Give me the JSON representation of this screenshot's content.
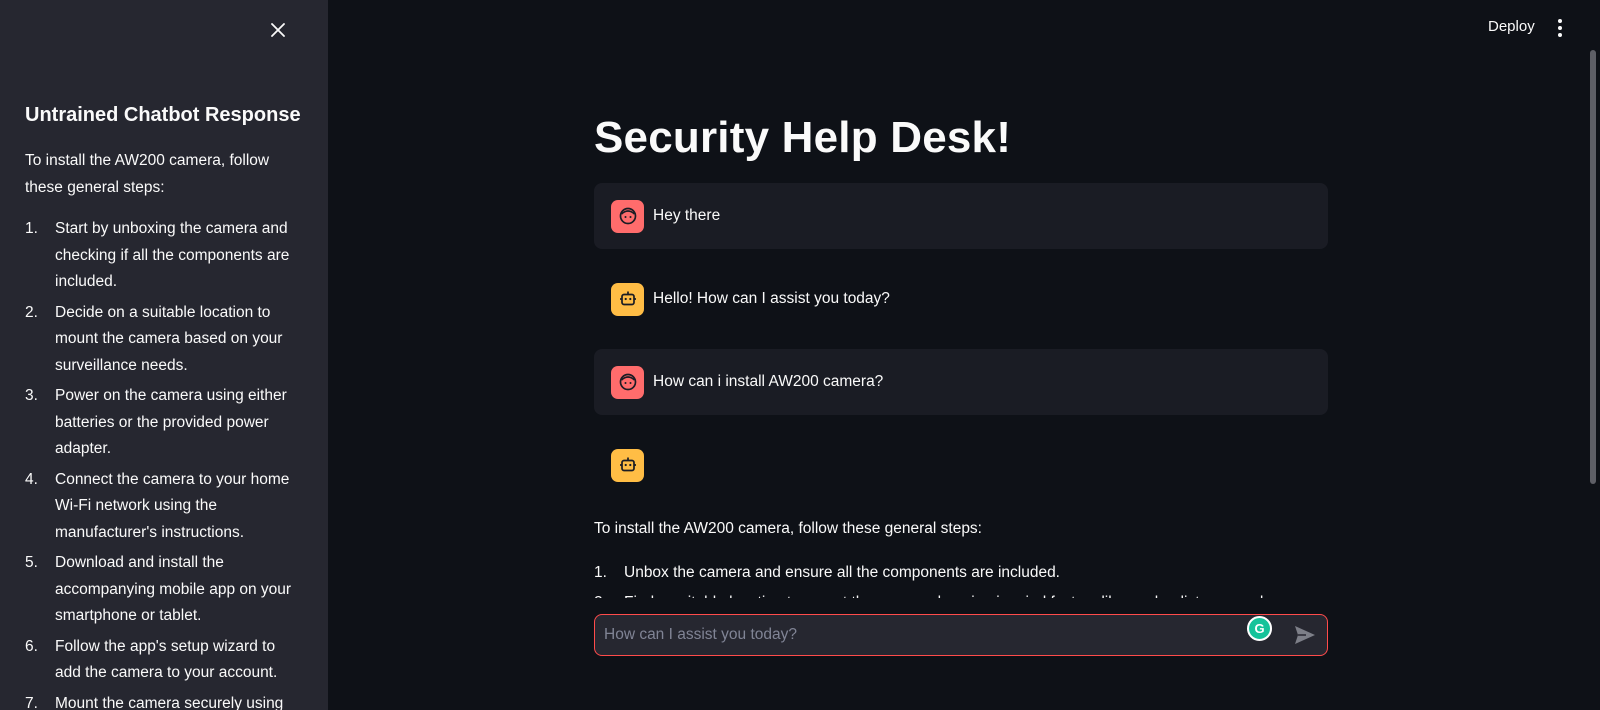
{
  "sidebar": {
    "title": "Untrained Chatbot Response",
    "intro": "To install the AW200 camera, follow these general steps:",
    "steps": [
      {
        "num": "1.",
        "text": "Start by unboxing the camera and checking if all the components are included."
      },
      {
        "num": "2.",
        "text": "Decide on a suitable location to mount the camera based on your surveillance needs."
      },
      {
        "num": "3.",
        "text": "Power on the camera using either batteries or the provided power adapter."
      },
      {
        "num": "4.",
        "text": "Connect the camera to your home Wi-Fi network using the manufacturer's instructions."
      },
      {
        "num": "5.",
        "text": "Download and install the accompanying mobile app on your smartphone or tablet."
      },
      {
        "num": "6.",
        "text": "Follow the app's setup wizard to add the camera to your account."
      },
      {
        "num": "7.",
        "text": "Mount the camera securely using"
      }
    ]
  },
  "header": {
    "deploy_label": "Deploy"
  },
  "main": {
    "title": "Security Help Desk!",
    "messages": [
      {
        "role": "user",
        "text": "Hey there"
      },
      {
        "role": "assistant",
        "text": "Hello! How can I assist you today?"
      },
      {
        "role": "user",
        "text": "How can i install AW200 camera?"
      },
      {
        "role": "assistant",
        "text": ""
      }
    ],
    "answer_intro": "To install the AW200 camera, follow these general steps:",
    "answer_steps": [
      {
        "num": "1.",
        "text": "Unbox the camera and ensure all the components are included."
      },
      {
        "num": "2.",
        "text": "Find a suitable location to mount the camera, keeping in mind factors like angle, distance and"
      }
    ]
  },
  "chat_input": {
    "placeholder": "How can I assist you today?",
    "value": ""
  },
  "icons": {
    "close": "close-icon",
    "menu": "more-vertical-icon",
    "user_avatar": "smiley-face-icon",
    "bot_avatar": "robot-icon",
    "send": "send-icon",
    "grammarly": "grammarly-icon"
  },
  "colors": {
    "background": "#0e1117",
    "sidebar": "#262730",
    "user_avatar": "#ff6c6c",
    "bot_avatar": "#ffbd45",
    "input_border": "#ff4b4b"
  }
}
